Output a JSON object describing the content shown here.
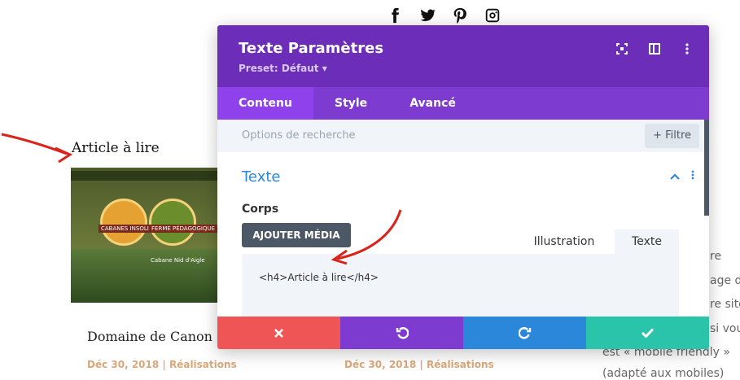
{
  "social": [
    "facebook-icon",
    "twitter-icon",
    "pinterest-icon",
    "instagram-icon"
  ],
  "page": {
    "article_title": "Article à lire",
    "post_title": "Domaine de Canon",
    "post_meta_left": "Déc 30, 2018 | Réalisations",
    "post_meta_right": "Déc 30, 2018 | Réalisations",
    "side_lines": [
      "re",
      "age d",
      "re site",
      "si vou",
      "est « mobile friendly »",
      "(adapté aux mobiles)"
    ]
  },
  "thumbnail": {
    "badge_left": "CABANES INSOLITES",
    "badge_right": "FERME PÉDAGOGIQUE",
    "caption": "Cabane Nid d'Aigle"
  },
  "modal": {
    "title": "Texte Paramètres",
    "preset": "Preset: Défaut ▾",
    "tabs": [
      "Contenu",
      "Style",
      "Avancé"
    ],
    "search_placeholder": "Options de recherche",
    "filter_label": "+ Filtre",
    "section_title": "Texte",
    "field_label": "Corps",
    "media_button": "AJOUTER MÉDIA",
    "editor_tabs": [
      "Illustration",
      "Texte"
    ],
    "editor_content": "<h4>Article à lire</h4>"
  },
  "colors": {
    "header": "#6c2eb9",
    "tabs": "#7e3bd0",
    "cancel": "#ef5555",
    "undo": "#7e3bd0",
    "redo": "#2b87da",
    "save": "#29c4a9",
    "annotation_arrow": "#d9241c"
  }
}
